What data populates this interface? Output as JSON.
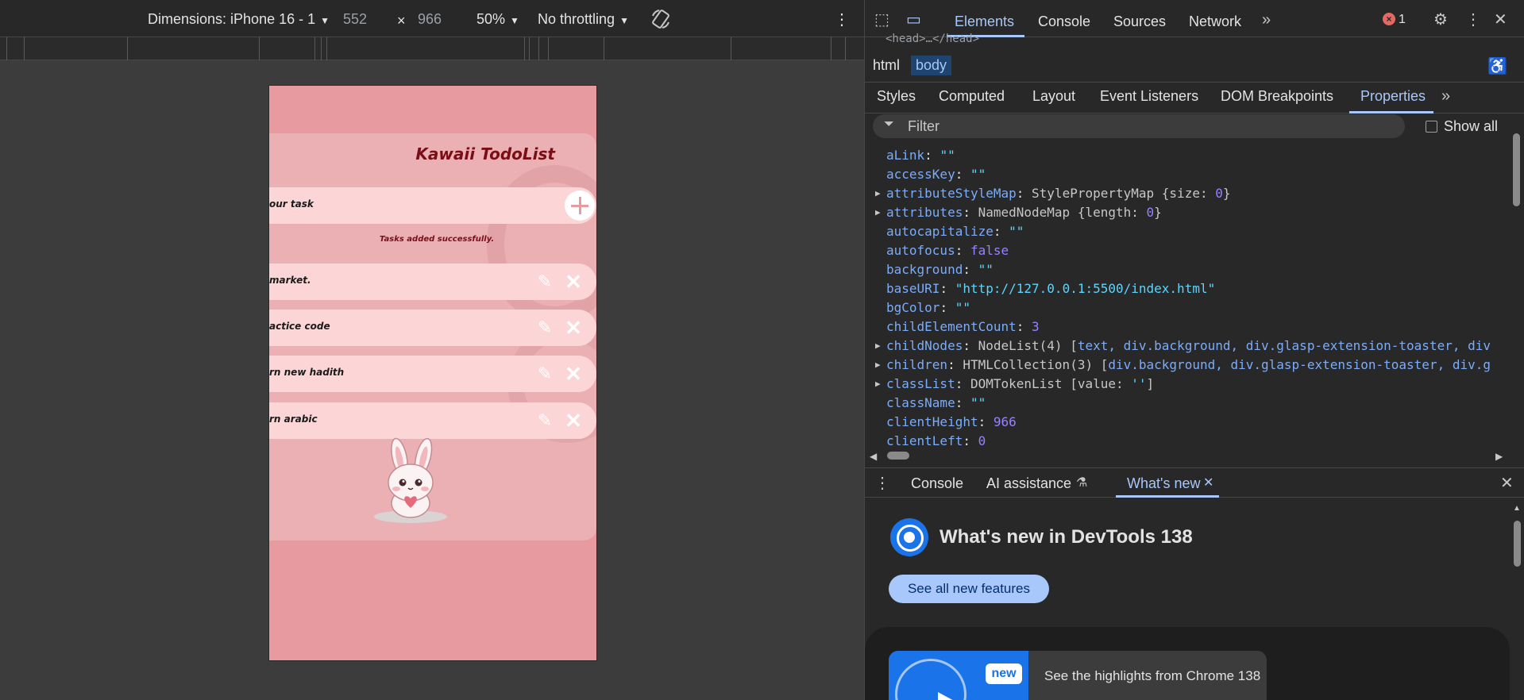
{
  "emulation": {
    "dimensions_label": "Dimensions: iPhone 16 - 1",
    "width": "552",
    "times": "×",
    "height": "966",
    "zoom": "50%",
    "throttling": "No throttling"
  },
  "phone_app": {
    "title": "Kawaii TodoList",
    "input_text": "our task",
    "message": "Tasks added successfully.",
    "tasks": [
      {
        "text": "market."
      },
      {
        "text": "actice code"
      },
      {
        "text": "rn new hadith"
      },
      {
        "text": "rn arabic"
      }
    ],
    "colors": {
      "background": "#e79ba0",
      "card": "#eab0b4",
      "row": "#fcd5d6",
      "title": "#7a0e16"
    }
  },
  "devtools": {
    "tabs": [
      "Elements",
      "Console",
      "Sources",
      "Network"
    ],
    "active_tab": "Elements",
    "error_count": "1",
    "breadcrumbs": [
      "html",
      "body"
    ],
    "subtabs": [
      "Styles",
      "Computed",
      "Layout",
      "Event Listeners",
      "DOM Breakpoints",
      "Properties"
    ],
    "active_subtab": "Properties",
    "filter_placeholder": "Filter",
    "show_all_label": "Show all",
    "partial_top_line": "<head>…</head>",
    "properties": [
      {
        "key": "aLink",
        "value": "\"\"",
        "type": "string"
      },
      {
        "key": "accessKey",
        "value": "\"\"",
        "type": "string"
      },
      {
        "key": "attributeStyleMap",
        "prefix": "StylePropertyMap {size: ",
        "num": "0",
        "suffix": "}",
        "expandable": true
      },
      {
        "key": "attributes",
        "prefix": "NamedNodeMap {length: ",
        "num": "0",
        "suffix": "}",
        "expandable": true
      },
      {
        "key": "autocapitalize",
        "value": "\"\"",
        "type": "string"
      },
      {
        "key": "autofocus",
        "value": "false",
        "type": "bool"
      },
      {
        "key": "background",
        "value": "\"\"",
        "type": "string"
      },
      {
        "key": "baseURI",
        "value": "\"http://127.0.0.1:5500/index.html\"",
        "type": "string"
      },
      {
        "key": "bgColor",
        "value": "\"\"",
        "type": "string"
      },
      {
        "key": "childElementCount",
        "value": "3",
        "type": "number"
      },
      {
        "key": "childNodes",
        "prefix": "NodeList(4) [",
        "rest": "text, div.background, div.glasp-extension-toaster, div",
        "expandable": true
      },
      {
        "key": "children",
        "prefix": "HTMLCollection(3) [",
        "rest": "div.background, div.glasp-extension-toaster, div.g",
        "expandable": true
      },
      {
        "key": "classList",
        "prefix": "DOMTokenList [value: ",
        "rest": "''",
        "suffix": "]",
        "expandable": true
      },
      {
        "key": "className",
        "value": "\"\"",
        "type": "string"
      },
      {
        "key": "clientHeight",
        "value": "966",
        "type": "number"
      },
      {
        "key": "clientLeft",
        "value": "0",
        "type": "number"
      }
    ],
    "drawer_tabs": [
      "Console",
      "AI assistance",
      "What's new"
    ],
    "active_drawer_tab": "What's new",
    "whats_new": {
      "title": "What's new in DevTools 138",
      "button": "See all new features",
      "badge": "new",
      "card_text": "See the highlights from Chrome 138"
    }
  }
}
